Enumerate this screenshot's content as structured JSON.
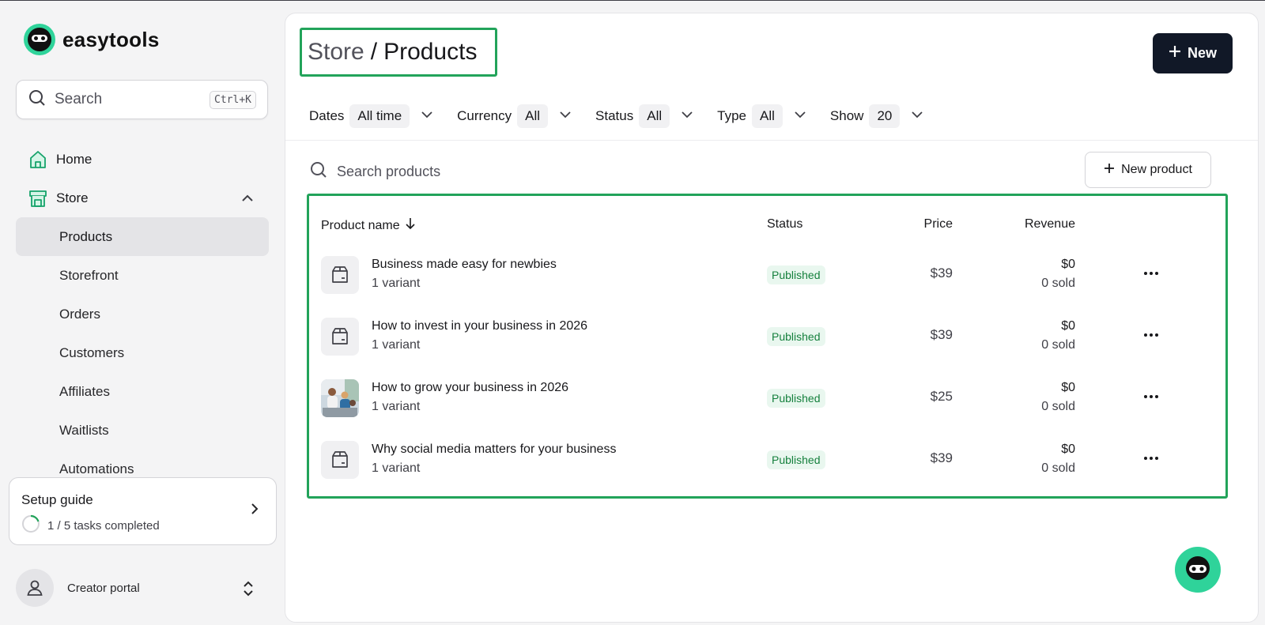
{
  "app": {
    "name": "easytools",
    "brand_color": "#2fd39a",
    "accent_color": "#22a35a"
  },
  "sidebar": {
    "search": {
      "label": "Search",
      "shortcut": "Ctrl+K"
    },
    "items": [
      {
        "label": "Home",
        "icon": "home-icon"
      },
      {
        "label": "Store",
        "icon": "store-icon",
        "expanded": true
      }
    ],
    "store_items": [
      {
        "label": "Products",
        "active": true
      },
      {
        "label": "Storefront"
      },
      {
        "label": "Orders"
      },
      {
        "label": "Customers"
      },
      {
        "label": "Affiliates"
      },
      {
        "label": "Waitlists"
      },
      {
        "label": "Automations"
      }
    ],
    "setup_guide": {
      "title": "Setup guide",
      "progress_text": "1 / 5 tasks completed",
      "progress_fraction": 0.2
    },
    "portal": {
      "label": "Creator portal"
    }
  },
  "header": {
    "breadcrumb": {
      "parent": "Store",
      "separator": "/",
      "current": "Products"
    },
    "new_button": "New"
  },
  "filters": [
    {
      "key": "Dates",
      "value": "All time"
    },
    {
      "key": "Currency",
      "value": "All"
    },
    {
      "key": "Status",
      "value": "All"
    },
    {
      "key": "Type",
      "value": "All"
    },
    {
      "key": "Show",
      "value": "20"
    }
  ],
  "products": {
    "search_placeholder": "Search products",
    "new_product_button": "New product",
    "columns": {
      "name": "Product name",
      "status": "Status",
      "price": "Price",
      "revenue": "Revenue"
    },
    "rows": [
      {
        "name": "Business made easy for newbies",
        "variants": "1 variant",
        "status": "Published",
        "price": "$39",
        "revenue": "$0",
        "sold": "0 sold",
        "thumb": "box-icon"
      },
      {
        "name": "How to invest in your business in 2026",
        "variants": "1 variant",
        "status": "Published",
        "price": "$39",
        "revenue": "$0",
        "sold": "0 sold",
        "thumb": "box-icon"
      },
      {
        "name": "How to grow your business in 2026",
        "variants": "1 variant",
        "status": "Published",
        "price": "$25",
        "revenue": "$0",
        "sold": "0 sold",
        "thumb": "photo"
      },
      {
        "name": "Why social media matters for your business",
        "variants": "1 variant",
        "status": "Published",
        "price": "$39",
        "revenue": "$0",
        "sold": "0 sold",
        "thumb": "box-icon"
      }
    ]
  }
}
